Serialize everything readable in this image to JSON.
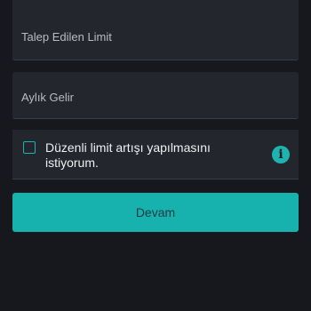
{
  "form": {
    "requested_limit_placeholder": "Talep Edilen Limit",
    "monthly_income_placeholder": "Aylık Gelir",
    "regular_increase_label": "Düzenli limit artışı yapılmasını istiyorum.",
    "regular_increase_checked": false,
    "info_icon_glyph": "i",
    "continue_label": "Devam"
  },
  "colors": {
    "background": "#16181d",
    "field_background": "#23262c",
    "accent": "#17b2ad"
  }
}
